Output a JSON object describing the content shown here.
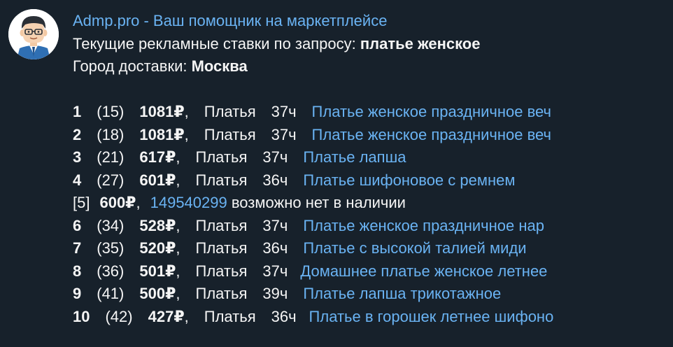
{
  "message": {
    "sender": "Admp.pro - Ваш помощник на маркетплейсе",
    "query_prefix": "Текущие рекламные ставки по запросу: ",
    "query_value": "платье женское",
    "city_prefix": "Город доставки: ",
    "city_value": "Москва",
    "rows": [
      {
        "rank": "1",
        "pos": "(15)",
        "price": "1081₽",
        "category": "Платья",
        "time": "37ч",
        "title": "Платье женское праздничное веч"
      },
      {
        "rank": "2",
        "pos": "(18)",
        "price": "1081₽",
        "category": "Платья",
        "time": "37ч",
        "title": "Платье женское праздничное веч"
      },
      {
        "rank": "3",
        "pos": "(21)",
        "price": "617₽",
        "category": "Платья",
        "time": "37ч",
        "title": "Платье лапша"
      },
      {
        "rank": "4",
        "pos": "(27)",
        "price": "601₽",
        "category": "Платья",
        "time": "36ч",
        "title": "Платье шифоновое с ремнем"
      }
    ],
    "special_row": {
      "rank": "[5]",
      "price": "600₽",
      "id": "149540299",
      "note": "возможно нет в наличии"
    },
    "rows2": [
      {
        "rank": "6",
        "pos": "(34)",
        "price": "528₽",
        "category": "Платья",
        "time": "37ч",
        "title": "Платье женское праздничное нар"
      },
      {
        "rank": "7",
        "pos": "(35)",
        "price": "520₽",
        "category": "Платья",
        "time": "36ч",
        "title": "Платье с высокой талией миди"
      },
      {
        "rank": "8",
        "pos": "(36)",
        "price": "501₽",
        "category": "Платья",
        "time": "37ч",
        "title": "Домашнее платье женское летнее"
      },
      {
        "rank": "9",
        "pos": "(41)",
        "price": "500₽",
        "category": "Платья",
        "time": "39ч",
        "title": "Платье лапша трикотажное"
      },
      {
        "rank": "10",
        "pos": "(42)",
        "price": "427₽",
        "category": "Платья",
        "time": "36ч",
        "title": "Платье в горошек летнее шифоно"
      }
    ]
  },
  "colors": {
    "background": "#17212b",
    "text": "#f5f5f5",
    "link": "#6ab3f3"
  },
  "icons": {
    "avatar": "cartoon-manager-avatar-icon"
  }
}
